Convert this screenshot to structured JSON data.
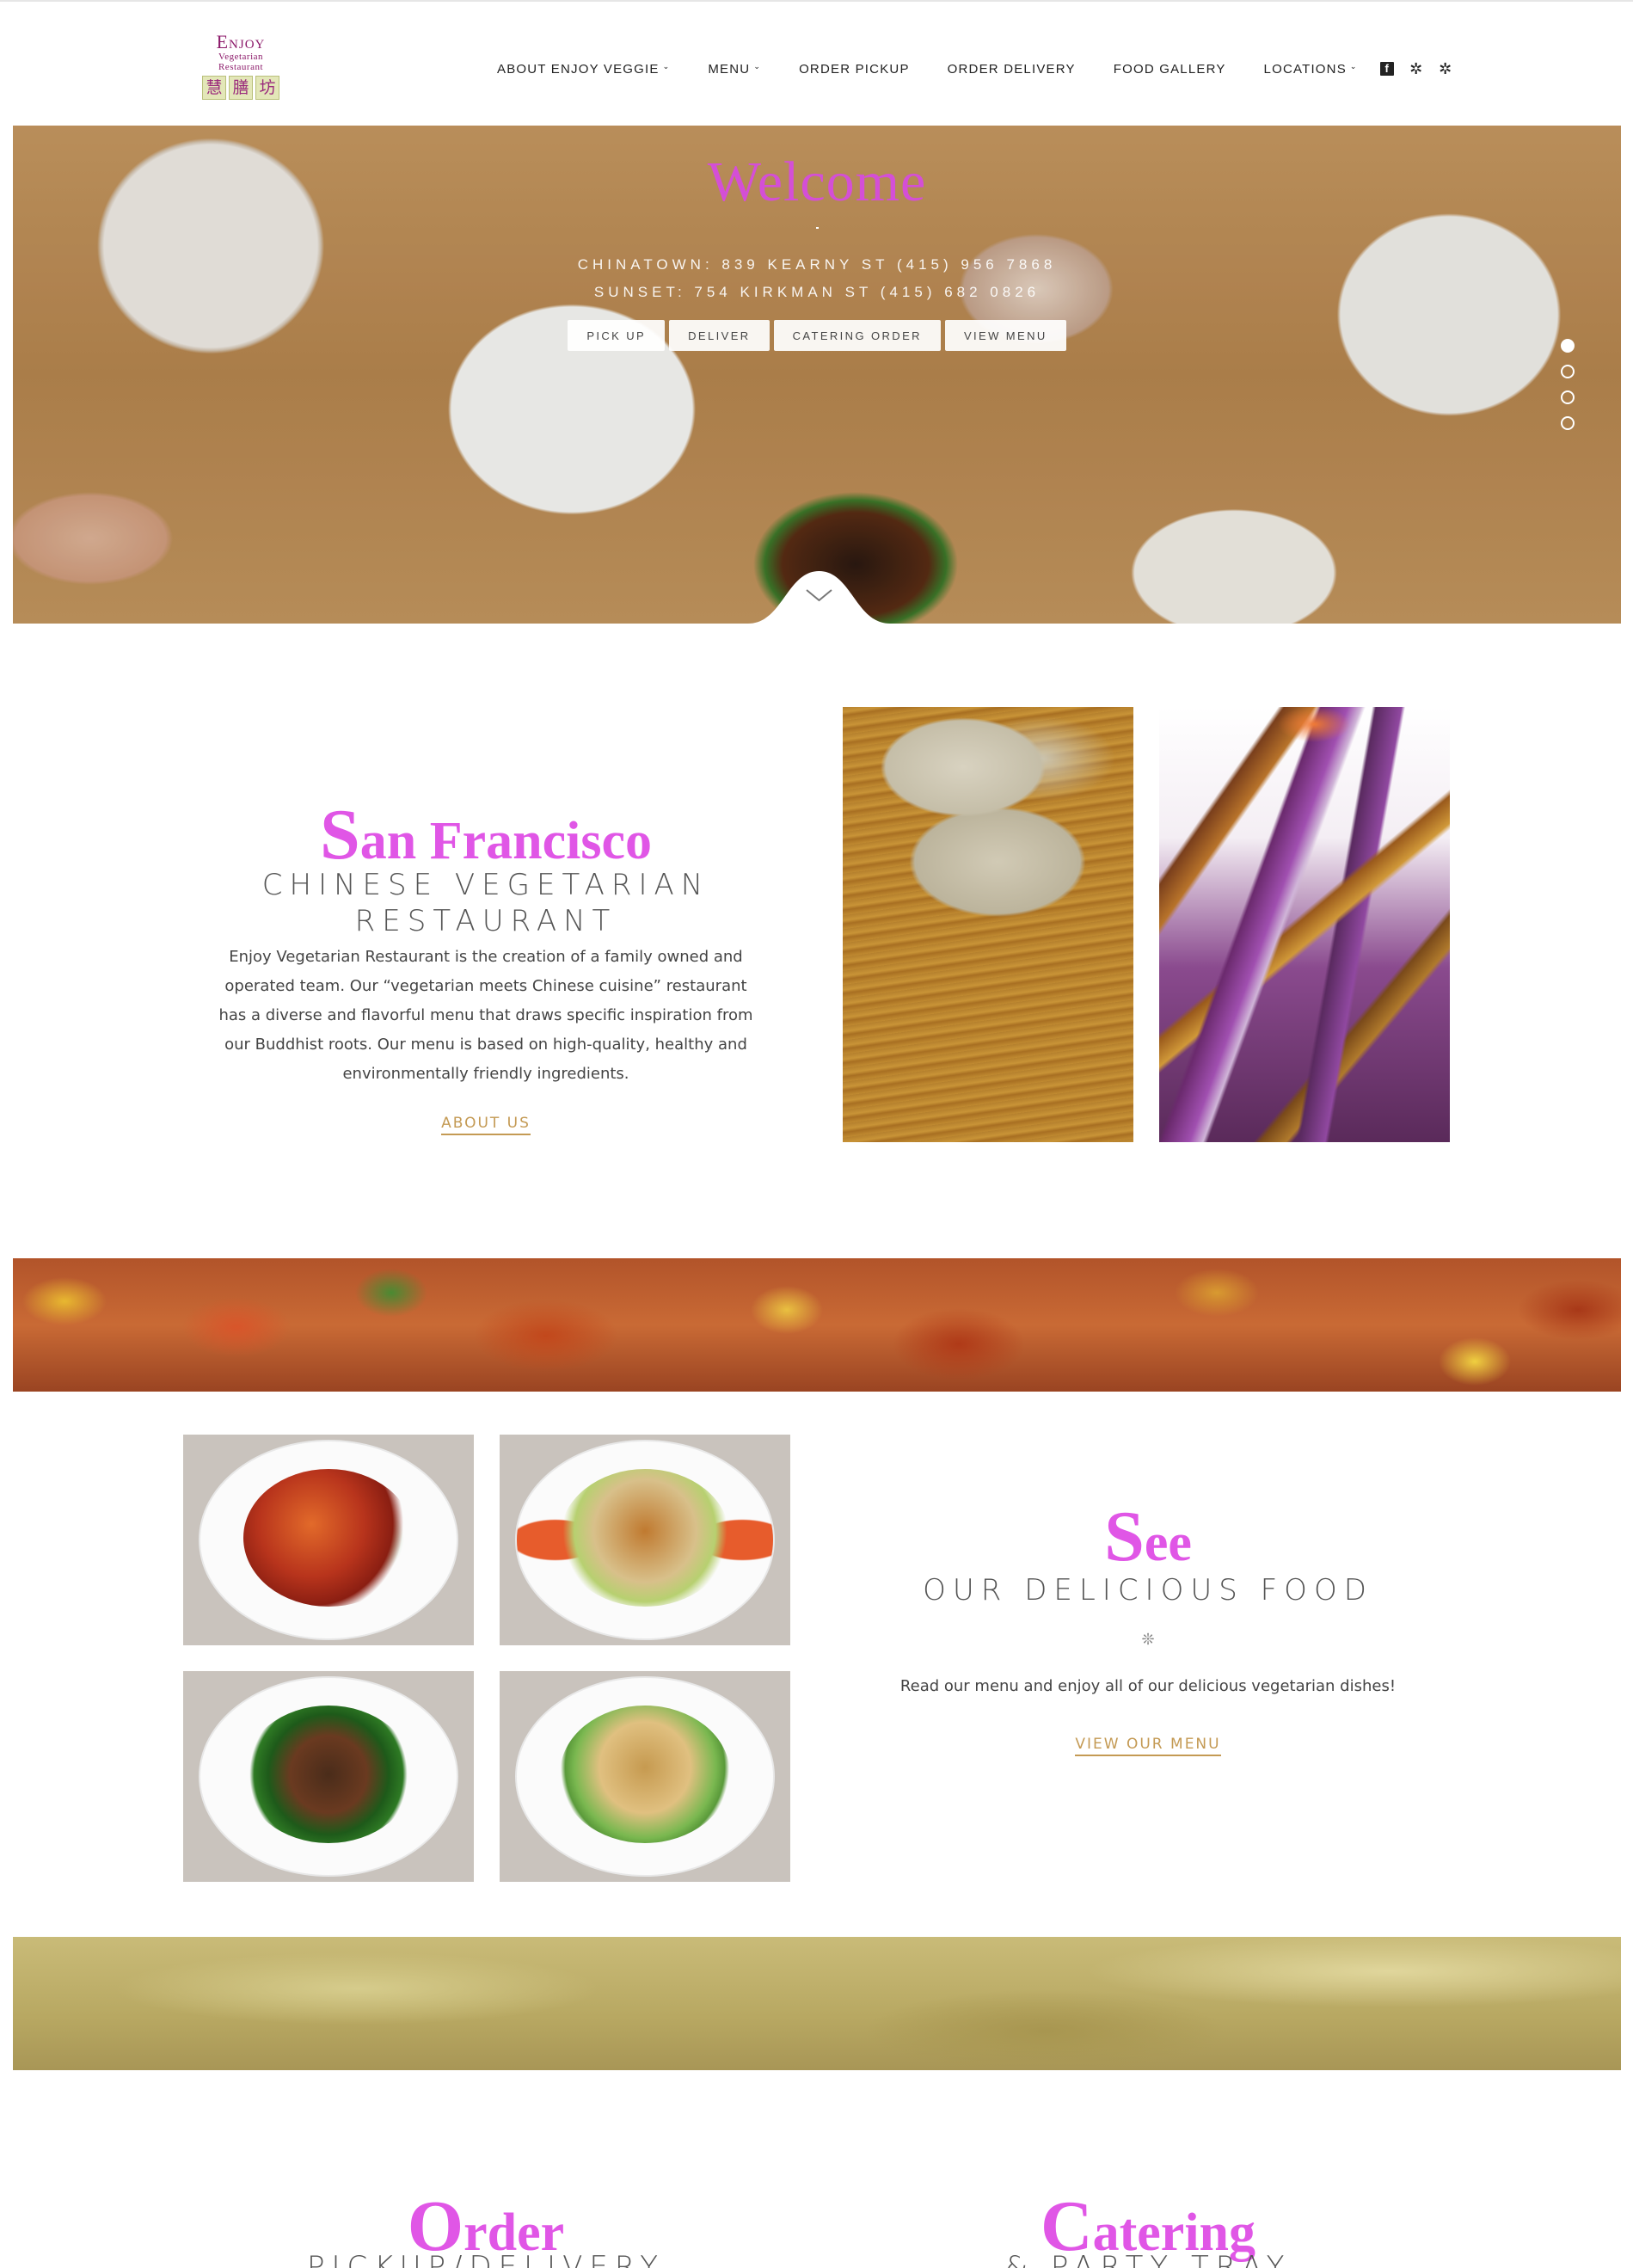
{
  "header": {
    "logo": {
      "line1": "Enjoy",
      "line2": "Vegetarian",
      "line3": "Restaurant",
      "chars": [
        "慧",
        "膳",
        "坊"
      ]
    },
    "nav": [
      {
        "label": "ABOUT ENJOY VEGGIE",
        "has_dropdown": true
      },
      {
        "label": "MENU",
        "has_dropdown": true
      },
      {
        "label": "ORDER PICKUP",
        "has_dropdown": false
      },
      {
        "label": "ORDER DELIVERY",
        "has_dropdown": false
      },
      {
        "label": "FOOD GALLERY",
        "has_dropdown": false
      },
      {
        "label": "LOCATIONS",
        "has_dropdown": true
      }
    ],
    "social": [
      {
        "icon": "facebook-icon",
        "glyph": "f"
      },
      {
        "icon": "yelp-icon",
        "glyph": "✲"
      },
      {
        "icon": "yelp-icon",
        "glyph": "✲"
      }
    ]
  },
  "hero": {
    "title": "Welcome",
    "line1": "CHINATOWN: 839 KEARNY ST (415) 956 7868",
    "line2": "SUNSET: 754 KIRKMAN ST (415) 682 0826",
    "buttons": [
      "PICK UP",
      "DELIVER",
      "CATERING ORDER",
      "VIEW MENU"
    ],
    "slides": 4,
    "active_slide": 1
  },
  "about": {
    "title_cap": "S",
    "title_rest": "an Francisco",
    "subtitle": "CHINESE VEGETARIAN RESTAURANT",
    "body": "Enjoy Vegetarian Restaurant is the creation of a family owned and operated team. Our “vegetarian meets Chinese cuisine” restaurant has a diverse and flavorful menu that draws specific inspiration from our Buddhist roots. Our menu is based on high-quality, healthy and environmentally friendly ingredients.",
    "link": "ABOUT US"
  },
  "see": {
    "title_cap": "S",
    "title_rest": "ee",
    "subtitle": "OUR DELICIOUS FOOD",
    "ornament": "❊",
    "body": "Read our menu and enjoy all of our delicious vegetarian dishes!",
    "link": "VIEW OUR MENU"
  },
  "bottom": {
    "order": {
      "title_cap": "O",
      "title_rest": "rder",
      "subtitle": "PICKUP/DELIVERY"
    },
    "catering": {
      "title_cap": "C",
      "title_rest": "atering",
      "subtitle": "& PARTY TRAY"
    }
  },
  "colors": {
    "accent_pink": "#e056e6",
    "accent_gold": "#c49a54",
    "logo_purple": "#8c1a6a"
  }
}
